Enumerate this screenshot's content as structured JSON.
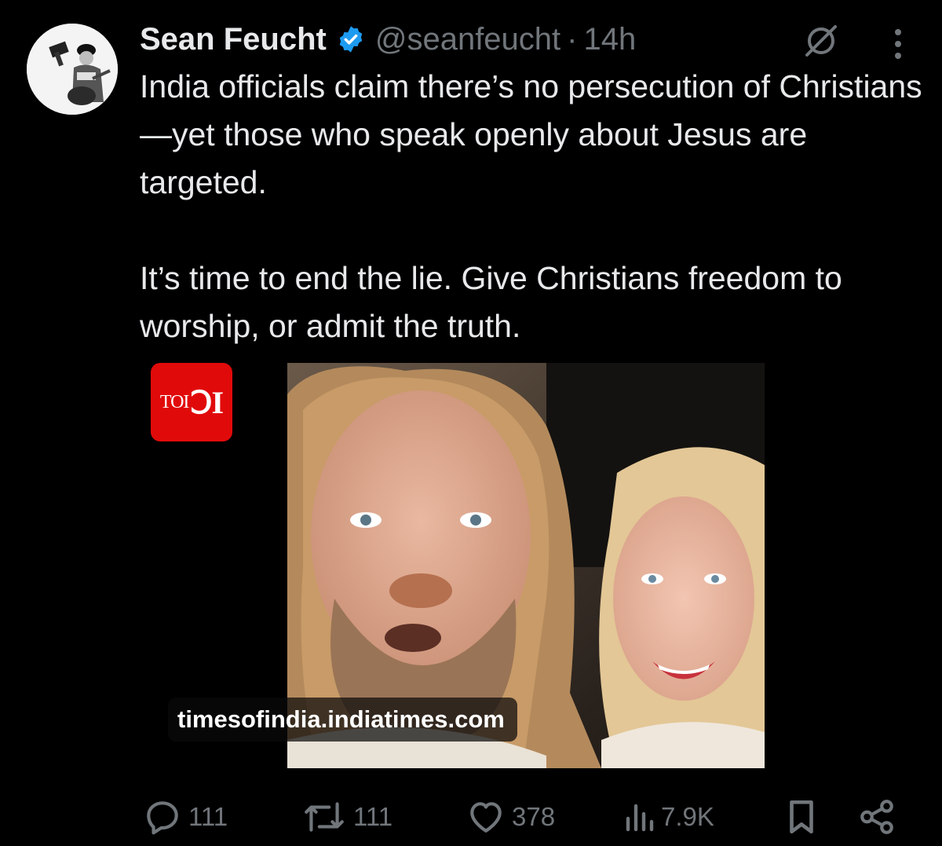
{
  "tweet": {
    "author_name": "Sean Feucht",
    "handle": "@seanfeucht",
    "separator": "·",
    "time": "14h",
    "paragraphs": [
      "India officials claim there’s no persecution of Christians—yet those who speak openly about Jesus are targeted.",
      "It’s time to end the lie. Give Christians freedom to worship, or admit the truth."
    ]
  },
  "link_card": {
    "domain": "timesofindia.indiatimes.com",
    "logo_text_small": "TOI",
    "logo_text_big": "ↃI"
  },
  "actions": {
    "replies": "111",
    "reposts": "111",
    "likes": "378",
    "views": "7.9K"
  },
  "colors": {
    "background": "#000000",
    "text": "#e7e9ea",
    "muted": "#71767b",
    "verified_blue": "#1d9bf0",
    "toi_red": "#e10a0a"
  },
  "icons": [
    "verified-badge-icon",
    "grok-icon",
    "more-icon",
    "reply-icon",
    "repost-icon",
    "like-icon",
    "views-icon",
    "bookmark-icon",
    "share-icon"
  ]
}
